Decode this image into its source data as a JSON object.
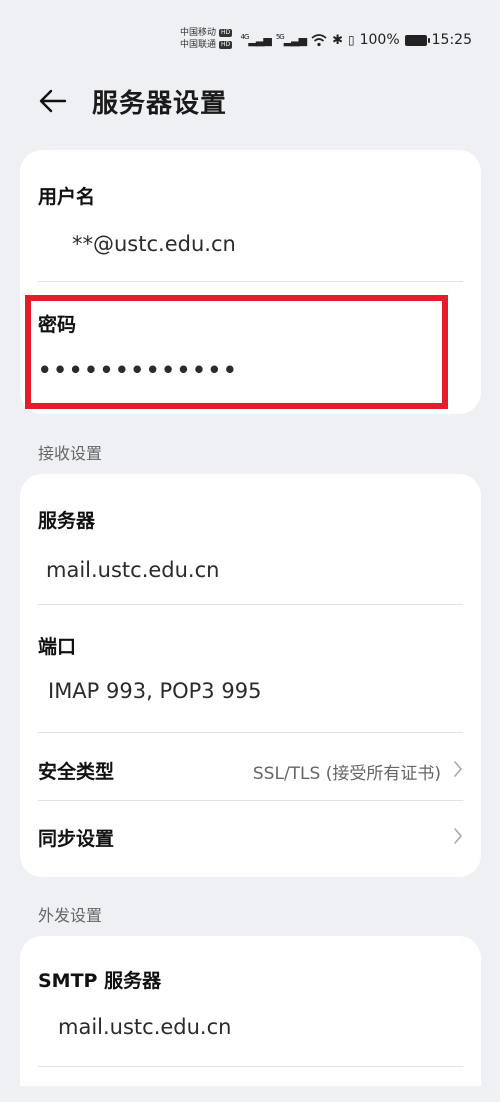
{
  "status": {
    "carrier1": "中国移动",
    "carrier2": "中国联通",
    "hd": "HD",
    "net": "4G",
    "net2": "5G",
    "battery": "100%",
    "time": "15:25"
  },
  "header": {
    "title": "服务器设置"
  },
  "account": {
    "username_label": "用户名",
    "username_value": "**@ustc.edu.cn",
    "password_label": "密码",
    "password_value": "•••••••••••••"
  },
  "incoming": {
    "section": "接收设置",
    "server_label": "服务器",
    "server_value": "mail.ustc.edu.cn",
    "port_label": "端口",
    "port_value": "IMAP 993, POP3 995",
    "security_label": "安全类型",
    "security_value": "SSL/TLS (接受所有证书)",
    "sync_label": "同步设置"
  },
  "outgoing": {
    "section": "外发设置",
    "smtp_label": "SMTP 服务器",
    "smtp_value": "mail.ustc.edu.cn"
  },
  "colors": {
    "highlight": "#e31e2a",
    "background": "#eef0f4"
  }
}
